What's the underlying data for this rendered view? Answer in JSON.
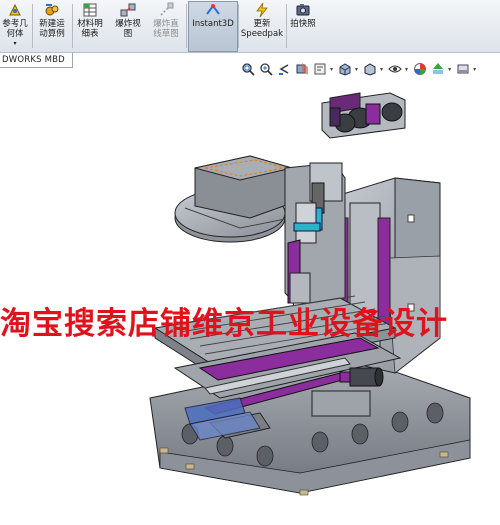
{
  "ribbon": {
    "items": [
      {
        "label": "参考几\n何体",
        "icon": "reference-geometry-icon",
        "dropdown": "▾"
      },
      {
        "label": "新建运\n动算例",
        "icon": "motion-study-icon"
      },
      {
        "label": "材料明\n细表",
        "icon": "bill-of-materials-icon"
      },
      {
        "label": "爆炸视\n图",
        "icon": "exploded-view-icon"
      },
      {
        "label": "爆炸直\n线草图",
        "icon": "explode-line-sketch-icon",
        "disabled": true
      },
      {
        "label": "Instant3D",
        "icon": "instant3d-icon",
        "active": true
      },
      {
        "label": "更新\nSpeedpak",
        "icon": "speedpak-icon"
      },
      {
        "label": "拍快照",
        "icon": "snapshot-icon"
      }
    ]
  },
  "tab": {
    "label": "DWORKS MBD"
  },
  "hud": {
    "icons": [
      "zoom-to-fit-icon",
      "zoom-area-icon",
      "previous-view-icon",
      "section-view-icon",
      "dynamic-annotation-icon",
      "view-orientation-icon",
      "display-style-icon",
      "hide-show-items-icon",
      "edit-appearance-icon",
      "apply-scene-icon",
      "view-settings-icon"
    ]
  },
  "watermark": {
    "text": "淘宝搜索店铺维京工业设备设计"
  },
  "colors": {
    "accent_purple": "#8b2d9c",
    "machine_gray": "#9aa0a8",
    "watermark_red": "#e0121b"
  }
}
